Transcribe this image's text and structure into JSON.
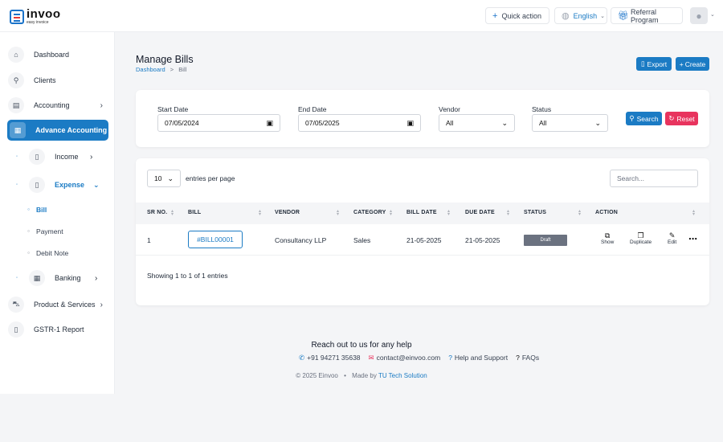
{
  "brand": {
    "name": "invoo",
    "tagline": "easy invoice"
  },
  "topbar": {
    "quick_action": "Quick action",
    "language": "English",
    "referral": "Referral Program"
  },
  "sidebar": {
    "dashboard": "Dashboard",
    "clients": "Clients",
    "accounting": "Accounting",
    "advance_accounting": "Advance Accounting",
    "income": "Income",
    "expense": "Expense",
    "bill": "Bill",
    "payment": "Payment",
    "debit_note": "Debit Note",
    "banking": "Banking",
    "product_services": "Product & Services",
    "gstr": "GSTR-1 Report"
  },
  "page": {
    "title": "Manage Bills",
    "crumb_root": "Dashboard",
    "crumb_sep": ">",
    "crumb_current": "Bill"
  },
  "actions": {
    "export": "Export",
    "create": "Create"
  },
  "filters": {
    "start_date_label": "Start Date",
    "start_date": "07/05/2024",
    "end_date_label": "End Date",
    "end_date": "07/05/2025",
    "vendor_label": "Vendor",
    "vendor": "All",
    "status_label": "Status",
    "status": "All",
    "search": "Search",
    "reset": "Reset"
  },
  "table": {
    "entries": "10",
    "entries_label": "entries per page",
    "search_placeholder": "Search...",
    "headers": [
      "SR NO.",
      "BILL",
      "VENDOR",
      "CATEGORY",
      "BILL DATE",
      "DUE DATE",
      "STATUS",
      "ACTION"
    ],
    "row": {
      "sr": "1",
      "bill": "#BILL00001",
      "vendor": "Consultancy LLP",
      "category": "Sales",
      "bill_date": "21-05-2025",
      "due_date": "21-05-2025",
      "status": "Draft"
    },
    "row_actions": {
      "show": "Show",
      "duplicate": "Duplicate",
      "edit": "Edit",
      "more": "⋯"
    },
    "showing": "Showing 1 to 1 of 1 entries"
  },
  "footer": {
    "title": "Reach out to us for any help",
    "phone": "+91 94271 35638",
    "email": "contact@einvoo.com",
    "support": "Help and Support",
    "faqs": "FAQs",
    "copyright": "© 2025 Einvoo",
    "sep": "•",
    "made_by_prefix": "Made by",
    "made_by": "TU Tech Solution"
  },
  "colors": {
    "accent": "#1b7bc4",
    "danger": "#e8345e",
    "draft": "#6b7280"
  },
  "icons": [
    "plus-icon",
    "globe-icon",
    "gift-icon",
    "user-icon",
    "home-icon",
    "user-plus-icon",
    "calculator-icon",
    "bank-icon",
    "file-icon",
    "cart-icon",
    "calendar-icon",
    "search-icon",
    "reset-icon",
    "external-link-icon",
    "copy-icon",
    "pencil-icon",
    "phone-icon",
    "mail-icon",
    "help-icon"
  ]
}
